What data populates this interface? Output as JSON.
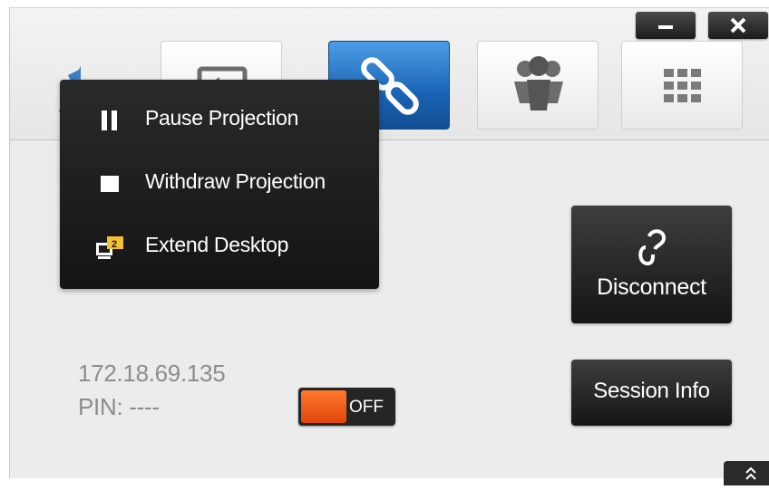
{
  "window": {
    "minimize_icon": "minimize-icon",
    "close_icon": "close-icon"
  },
  "tabs": [
    {
      "name": "screen-share",
      "icon": "share-screen-icon",
      "active": false
    },
    {
      "name": "connection",
      "icon": "link-icon",
      "active": true
    },
    {
      "name": "participants",
      "icon": "people-icon",
      "active": false
    },
    {
      "name": "apps",
      "icon": "grid-icon",
      "active": false
    }
  ],
  "projection_menu": {
    "items": [
      {
        "label": "Pause Projection",
        "icon": "pause-icon"
      },
      {
        "label": "Withdraw Projection",
        "icon": "stop-icon"
      },
      {
        "label": "Extend Desktop",
        "icon": "extend-desktop-icon"
      }
    ]
  },
  "connection": {
    "ip": "172.18.69.135",
    "pin_label": "PIN: ----",
    "toggle_state": "OFF"
  },
  "buttons": {
    "disconnect": "Disconnect",
    "session_info": "Session Info"
  },
  "colors": {
    "accent": "#1a63b4",
    "toggle": "#f0561a",
    "popup_bg": "#1c1c1c"
  }
}
